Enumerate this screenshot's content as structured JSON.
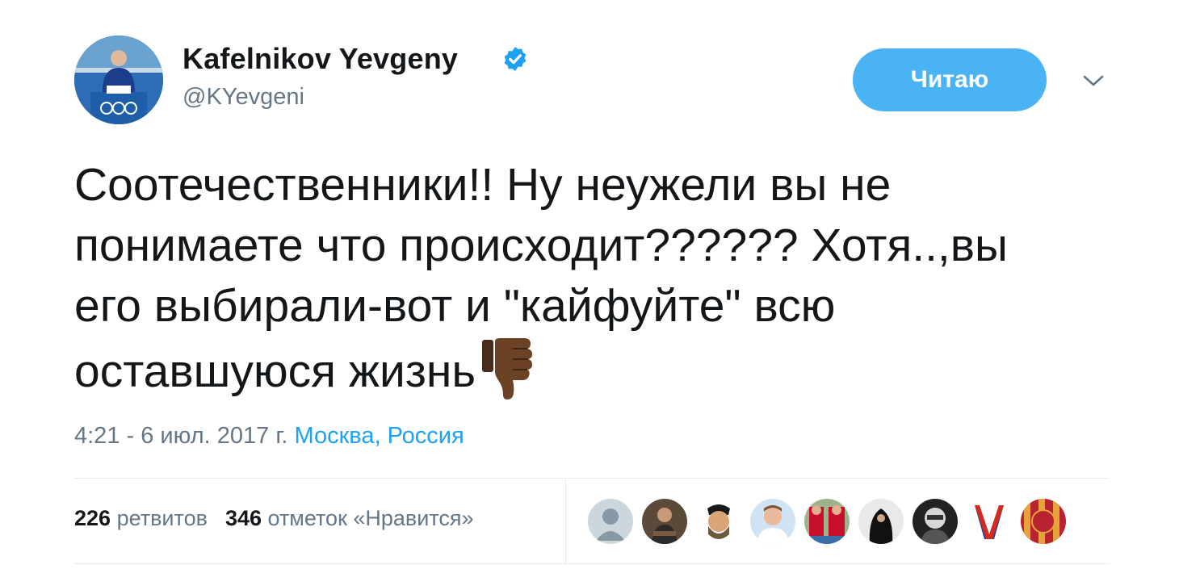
{
  "author": {
    "name": "Kafelnikov Yevgeny",
    "handle": "@KYevgeni",
    "verified_icon": "verified-badge-icon",
    "avatar_icon": "profile-photo"
  },
  "follow_button": {
    "label": "Читаю"
  },
  "menu": {
    "icon": "chevron-down-icon"
  },
  "tweet": {
    "lines": [
      "Соотечественники!! Ну неужели вы не",
      "понимаете что происходит?????? Хотя..,вы",
      "его выбирали-вот и \"кайфуйте\" всю",
      "оставшуюся жизнь"
    ],
    "emoji": "thumbs-down-icon"
  },
  "meta": {
    "timestamp": "4:21 - 6 июл. 2017 г.",
    "location": "Москва, Россия"
  },
  "stats": {
    "retweets_count": "226",
    "retweets_label": "ретвитов",
    "likes_count": "346",
    "likes_label": "отметок «Нравится»"
  },
  "likers": [
    "default-avatar-icon",
    "user-avatar",
    "user-avatar",
    "user-avatar",
    "user-avatar",
    "user-avatar",
    "user-avatar",
    "user-avatar",
    "user-avatar"
  ],
  "colors": {
    "accent": "#1da1f2",
    "button": "#4ab3f4",
    "text": "#14171a",
    "secondary": "#657786",
    "border": "#e6ecf0"
  }
}
